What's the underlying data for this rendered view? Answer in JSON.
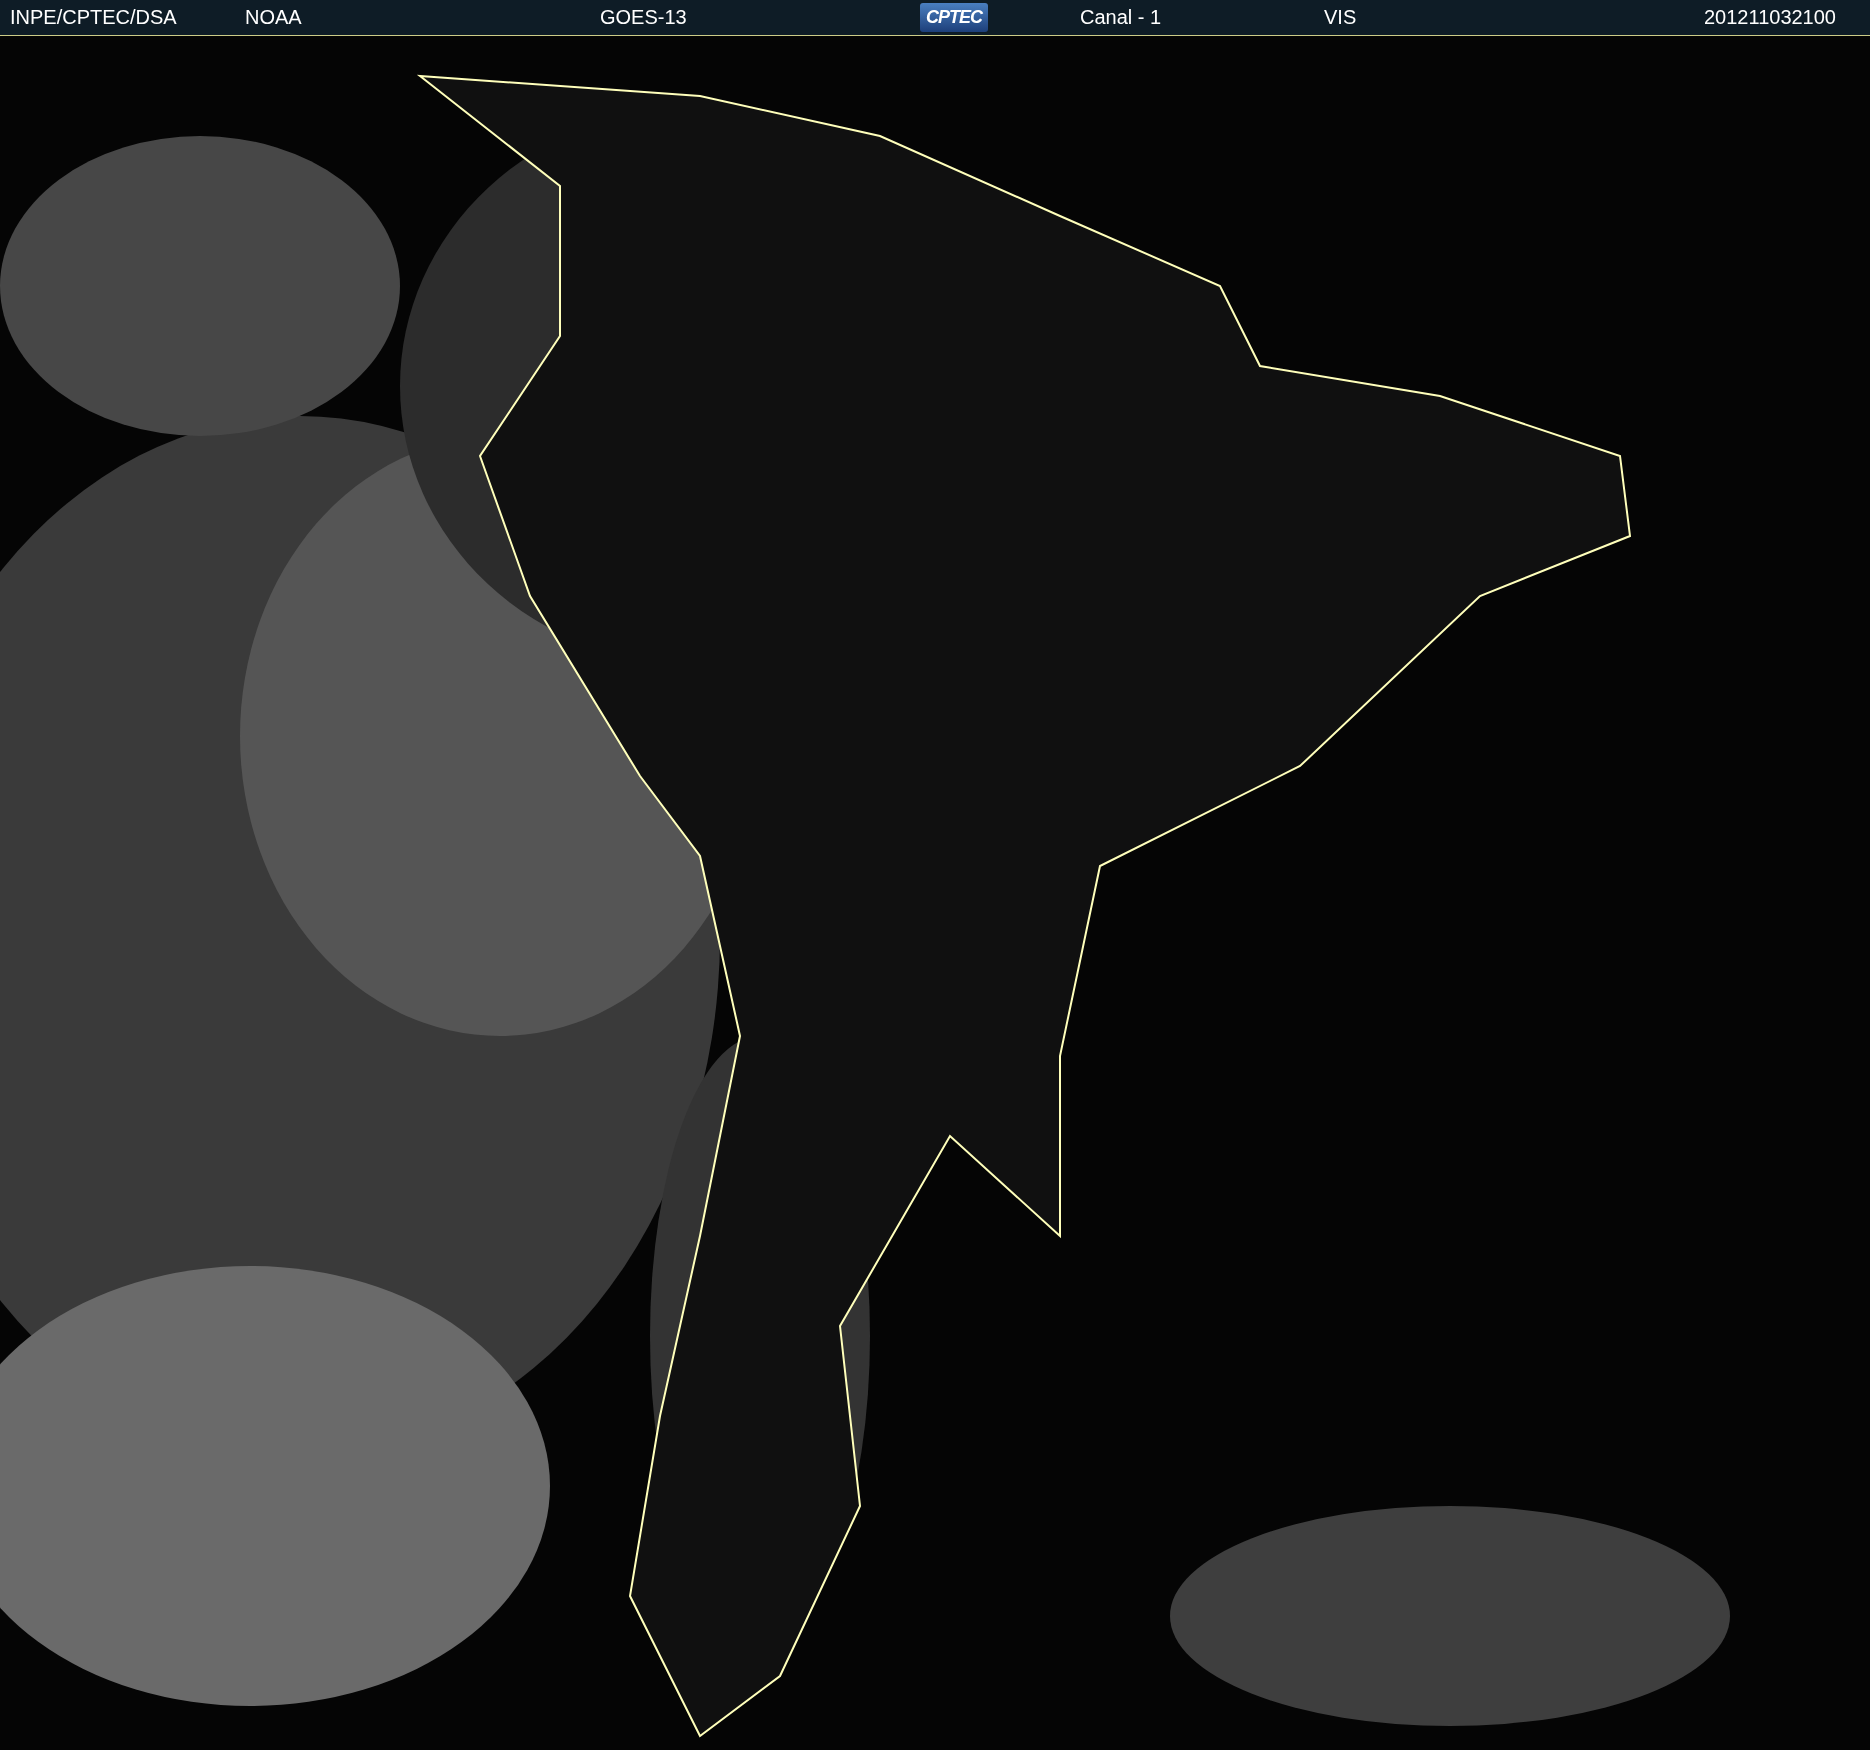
{
  "header": {
    "source": "INPE/CPTEC/DSA",
    "agency": "NOAA",
    "satellite": "GOES-13",
    "logo": "CPTEC",
    "channel": "Canal - 1",
    "band": "VIS",
    "timestamp": "201211032100"
  }
}
